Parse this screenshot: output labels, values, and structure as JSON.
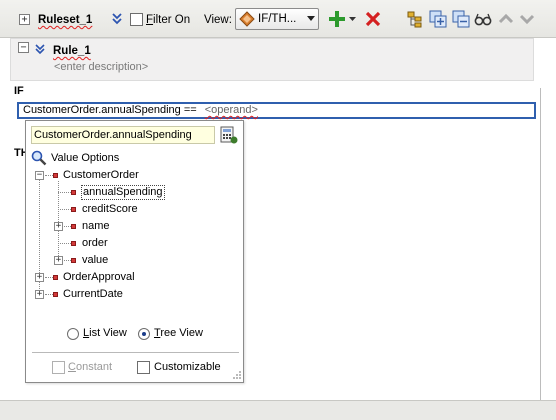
{
  "toolbar": {
    "ruleset_label": "Ruleset_1",
    "filter_label": "Filter On",
    "filter_checked": false,
    "view_label": "View:",
    "view_value": "IF/TH...",
    "colors": {
      "add": "#2c9a2c",
      "delete": "#d42020",
      "selection": "#2f5fae"
    }
  },
  "rule": {
    "name": "Rule_1",
    "description_placeholder": "<enter description>"
  },
  "if_section": {
    "label": "IF",
    "condition_left": "CustomerOrder.annualSpending ==",
    "condition_operand": "<operand>"
  },
  "then_section": {
    "label_partial": "TH"
  },
  "value_popup": {
    "expression": "CustomerOrder.annualSpending",
    "options_title": "Value Options",
    "tree": [
      {
        "label": "CustomerOrder",
        "expanded": true
      },
      {
        "label": "annualSpending",
        "selected": true
      },
      {
        "label": "creditScore"
      },
      {
        "label": "name",
        "expandable": true
      },
      {
        "label": "order"
      },
      {
        "label": "value",
        "expandable": true
      },
      {
        "label": "OrderApproval",
        "expandable": true
      },
      {
        "label": "CurrentDate",
        "expandable": true
      }
    ],
    "list_view_label": "List View",
    "tree_view_label": "Tree View",
    "selected_view": "Tree View",
    "constant_label": "Constant",
    "constant_enabled": false,
    "customizable_label": "Customizable",
    "customizable_checked": false
  }
}
